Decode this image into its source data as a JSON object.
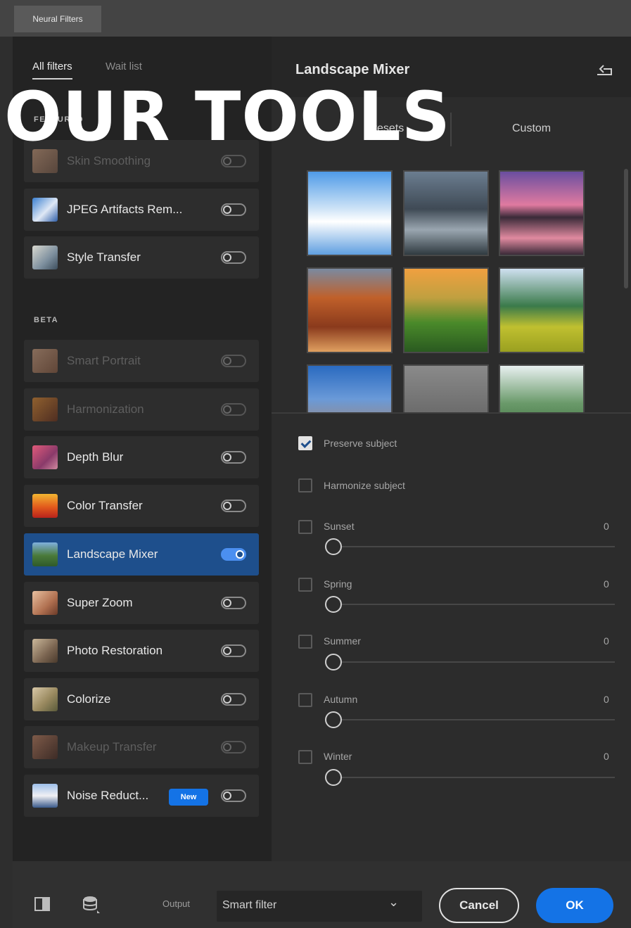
{
  "window": {
    "title": "Neural Filters"
  },
  "left": {
    "tabs": [
      {
        "label": "All filters",
        "active": true
      },
      {
        "label": "Wait list",
        "active": false
      }
    ],
    "featured_label": "FEATURED",
    "beta_label": "BETA",
    "featured": [
      {
        "label": "Skin Smoothing",
        "enabled": false,
        "dim": true,
        "icon": "skin-smoothing-thumb"
      },
      {
        "label": "JPEG Artifacts Rem...",
        "enabled": false,
        "dim": false,
        "icon": "jpeg-artifacts-thumb"
      },
      {
        "label": "Style Transfer",
        "enabled": false,
        "dim": false,
        "icon": "style-transfer-thumb"
      }
    ],
    "beta": [
      {
        "label": "Smart Portrait",
        "enabled": false,
        "dim": true,
        "icon": "smart-portrait-thumb"
      },
      {
        "label": "Harmonization",
        "enabled": false,
        "dim": true,
        "icon": "harmonization-thumb"
      },
      {
        "label": "Depth Blur",
        "enabled": false,
        "dim": false,
        "icon": "depth-blur-thumb"
      },
      {
        "label": "Color Transfer",
        "enabled": false,
        "dim": false,
        "icon": "color-transfer-thumb"
      },
      {
        "label": "Landscape Mixer",
        "enabled": true,
        "dim": false,
        "selected": true,
        "icon": "landscape-mixer-thumb"
      },
      {
        "label": "Super Zoom",
        "enabled": false,
        "dim": false,
        "icon": "super-zoom-thumb"
      },
      {
        "label": "Photo Restoration",
        "enabled": false,
        "dim": false,
        "icon": "photo-restoration-thumb"
      },
      {
        "label": "Colorize",
        "enabled": false,
        "dim": false,
        "icon": "colorize-thumb"
      },
      {
        "label": "Makeup Transfer",
        "enabled": false,
        "dim": true,
        "icon": "makeup-transfer-thumb"
      },
      {
        "label": "Noise Reduct...",
        "enabled": false,
        "dim": false,
        "badge": "New",
        "icon": "noise-reduction-thumb"
      }
    ]
  },
  "right": {
    "title": "Landscape Mixer",
    "segments": {
      "presets": "Presets",
      "custom": "Custom"
    },
    "options": [
      {
        "label": "Preserve subject",
        "checked": true
      },
      {
        "label": "Harmonize subject",
        "checked": false
      }
    ],
    "sliders": [
      {
        "label": "Sunset",
        "value": "0"
      },
      {
        "label": "Spring",
        "value": "0"
      },
      {
        "label": "Summer",
        "value": "0"
      },
      {
        "label": "Autumn",
        "value": "0"
      },
      {
        "label": "Winter",
        "value": "0"
      }
    ]
  },
  "footer": {
    "output_label": "Output",
    "output_value": "Smart filter",
    "cancel": "Cancel",
    "ok": "OK"
  },
  "overlay_text": "OUR TOOLS",
  "colors": {
    "accent": "#1473e6",
    "selected_row": "#1e4f8c",
    "panel": "#232323"
  }
}
